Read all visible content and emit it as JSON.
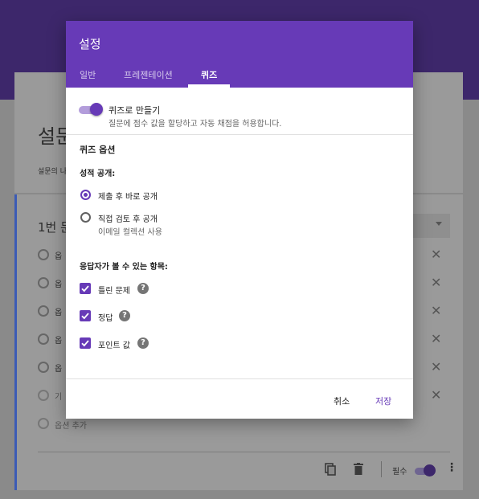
{
  "background": {
    "title_partial": "설문",
    "desc_partial": "설문의 나",
    "question_partial": "1번 문",
    "option_partial": "옵",
    "other_partial": "기",
    "add_option": "옵션 추가",
    "required_label": "필수"
  },
  "dialog": {
    "title": "설정",
    "tabs": [
      {
        "label": "일반",
        "active": false
      },
      {
        "label": "프레젠테이션",
        "active": false
      },
      {
        "label": "퀴즈",
        "active": true
      }
    ],
    "quiz_toggle": {
      "label": "퀴즈로 만들기",
      "description": "질문에 점수 값을 할당하고 자동 채점을 허용합니다."
    },
    "quiz_options_heading": "퀴즈 옵션",
    "grade_release": {
      "heading": "성적 공개:",
      "options": [
        {
          "label": "제출 후 바로 공개",
          "checked": true,
          "sub": ""
        },
        {
          "label": "직접 검토 후 공개",
          "checked": false,
          "sub": "이메일 컬렉션 사용"
        }
      ]
    },
    "respondent_view": {
      "heading": "응답자가 볼 수 있는 항목:",
      "items": [
        {
          "label": "틀린 문제",
          "checked": true
        },
        {
          "label": "정답",
          "checked": true
        },
        {
          "label": "포인트 값",
          "checked": true
        }
      ]
    },
    "cancel_label": "취소",
    "save_label": "저장"
  },
  "colors": {
    "accent": "#673ab7",
    "header_bg": "#3d276b"
  }
}
